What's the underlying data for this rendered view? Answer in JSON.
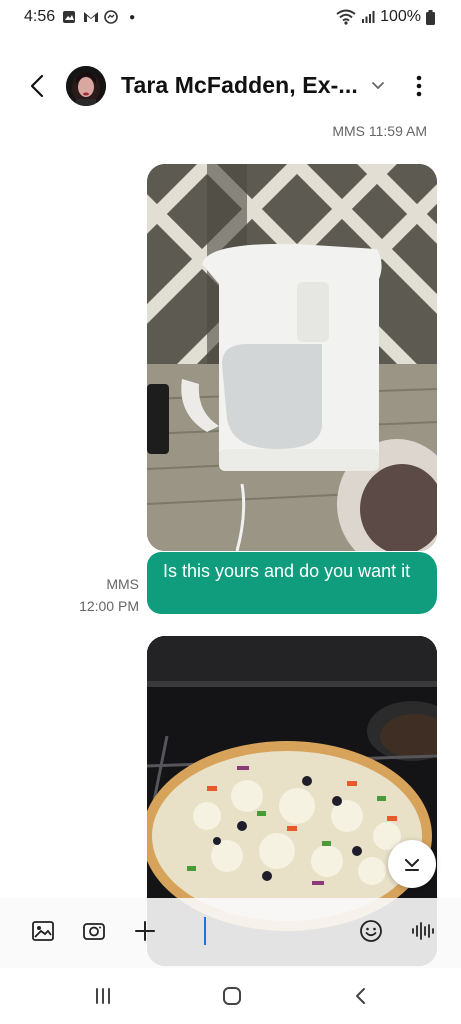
{
  "status_bar": {
    "time": "4:56",
    "battery_text": "100%",
    "left_icons": [
      "gallery-notification-icon",
      "gmail-icon",
      "messenger-icon",
      "dot-icon"
    ],
    "right_icons": [
      "wifi-icon",
      "signal-icon",
      "battery-icon"
    ]
  },
  "header": {
    "contact_name": "Tara McFadden, Ex-...",
    "icons": [
      "back-arrow-icon",
      "avatar",
      "chevron-down-icon",
      "more-vertical-icon"
    ]
  },
  "messages": [
    {
      "type": "mms-image",
      "meta": "MMS 11:59 AM",
      "image_subject": "white coffee maker on deck"
    },
    {
      "type": "mms-text",
      "meta_label": "MMS",
      "meta_time": "12:00 PM",
      "text": "Is this yours and do you want it"
    },
    {
      "type": "mms-image",
      "image_subject": "pizza with cheese in oven"
    }
  ],
  "composer": {
    "icons": [
      "gallery-icon",
      "camera-icon",
      "plus-icon",
      "emoji-icon",
      "voice-icon"
    ],
    "input_value": ""
  },
  "nav_bar": {
    "icons": [
      "recents-icon",
      "home-icon",
      "back-icon"
    ]
  },
  "colors": {
    "accent": "#0f9d7d",
    "meta_text": "#666666",
    "caret": "#1a73e8"
  }
}
